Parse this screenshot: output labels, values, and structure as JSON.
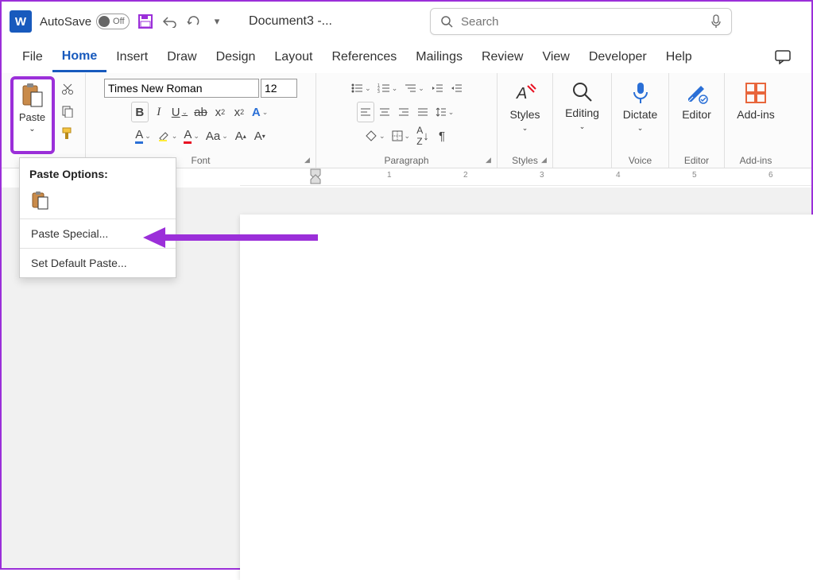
{
  "titlebar": {
    "autosave_label": "AutoSave",
    "autosave_state": "Off",
    "document_name": "Document3 -...",
    "search_placeholder": "Search"
  },
  "tabs": [
    "File",
    "Home",
    "Insert",
    "Draw",
    "Design",
    "Layout",
    "References",
    "Mailings",
    "Review",
    "View",
    "Developer",
    "Help"
  ],
  "active_tab": "Home",
  "ribbon": {
    "clipboard": {
      "paste": "Paste"
    },
    "font": {
      "name": "Times New Roman",
      "size": "12",
      "bold": "B",
      "italic": "I",
      "group_label": "Font"
    },
    "paragraph": {
      "group_label": "Paragraph"
    },
    "styles": {
      "big": "Styles",
      "group_label": "Styles"
    },
    "editing": {
      "big": "Editing"
    },
    "dictate": {
      "big": "Dictate",
      "group_label": "Voice"
    },
    "editor": {
      "big": "Editor",
      "group_label": "Editor"
    },
    "addins": {
      "big": "Add-ins",
      "group_label": "Add-ins"
    }
  },
  "paste_menu": {
    "header": "Paste Options:",
    "special": "Paste Special...",
    "default": "Set Default Paste..."
  },
  "ruler_marks": [
    "1",
    "2",
    "3",
    "4",
    "5",
    "6"
  ]
}
